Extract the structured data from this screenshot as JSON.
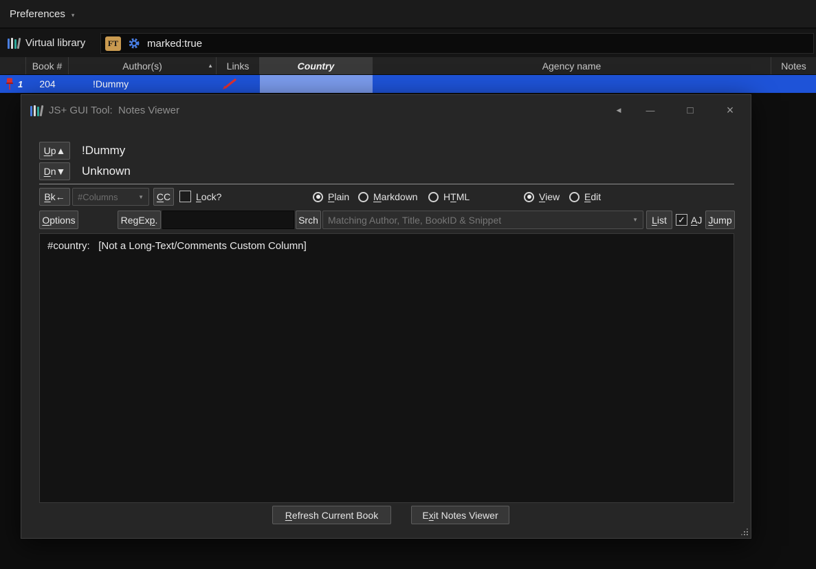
{
  "topbar": {
    "preferences": "Preferences"
  },
  "toolbar": {
    "virtual_library": "Virtual library",
    "ft_badge": "FT",
    "search_query": "marked:true"
  },
  "table": {
    "headers": {
      "book_number": "Book #",
      "authors": "Author(s)",
      "links": "Links",
      "country": "Country",
      "agency_name": "Agency name",
      "notes": "Notes"
    },
    "selected_row": {
      "row_number": "1",
      "book_number": "204",
      "authors": "!Dummy"
    }
  },
  "dialog": {
    "title": "JS+ GUI Tool:  Notes Viewer",
    "up_button": "&Up▲",
    "down_button": "&Dn▼",
    "book_title": "!Dummy",
    "book_author": "Unknown",
    "bk_button": "&Bk←",
    "columns_dropdown": "#Columns",
    "cc_button": "&CC",
    "lock_label": "&Lock?",
    "format_options": {
      "plain": "&Plain",
      "markdown": "&Markdown",
      "html": "H&TML"
    },
    "mode_options": {
      "view": "&View",
      "edit": "&Edit"
    },
    "options_button": "&Options",
    "regexp_button": "RegEx&p.",
    "srch_button": "Srch",
    "match_dropdown_placeholder": "Matching Author, Title, BookID & Snippet",
    "list_button": "&List",
    "aj_label": "&AJ",
    "jump_button": "&Jump",
    "notes_content": "#country:   [Not a Long-Text/Comments Custom Column]",
    "refresh_button": "&Refresh Current Book",
    "exit_button": "E&xit Notes Viewer"
  },
  "icons": {
    "caret_down": "▼",
    "menu_caret": "▾",
    "sort_ascending": "▲",
    "back": "◀",
    "minimize": "—",
    "maximize": "□",
    "close": "×",
    "check": "✓"
  }
}
